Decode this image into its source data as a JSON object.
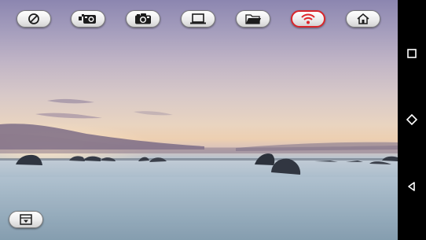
{
  "toolbar": {
    "items": [
      {
        "icon": "no-entry-icon"
      },
      {
        "icon": "video-camera-icon"
      },
      {
        "icon": "camera-icon"
      },
      {
        "icon": "laptop-icon"
      },
      {
        "icon": "folder-icon"
      },
      {
        "icon": "wifi-icon",
        "active": true
      },
      {
        "icon": "home-icon"
      }
    ]
  },
  "bottom_left_button": {
    "icon": "tray-down-icon"
  },
  "nav_bar": {
    "buttons": [
      {
        "icon": "recent-apps-icon"
      },
      {
        "icon": "home-icon"
      },
      {
        "icon": "back-icon"
      }
    ]
  },
  "colors": {
    "active_border": "#d8262b",
    "wifi_active": "#e0262b",
    "nav_background": "#000000",
    "nav_icon": "#ffffff"
  },
  "background": {
    "scene": "seascape-sunset-with-rocks"
  }
}
